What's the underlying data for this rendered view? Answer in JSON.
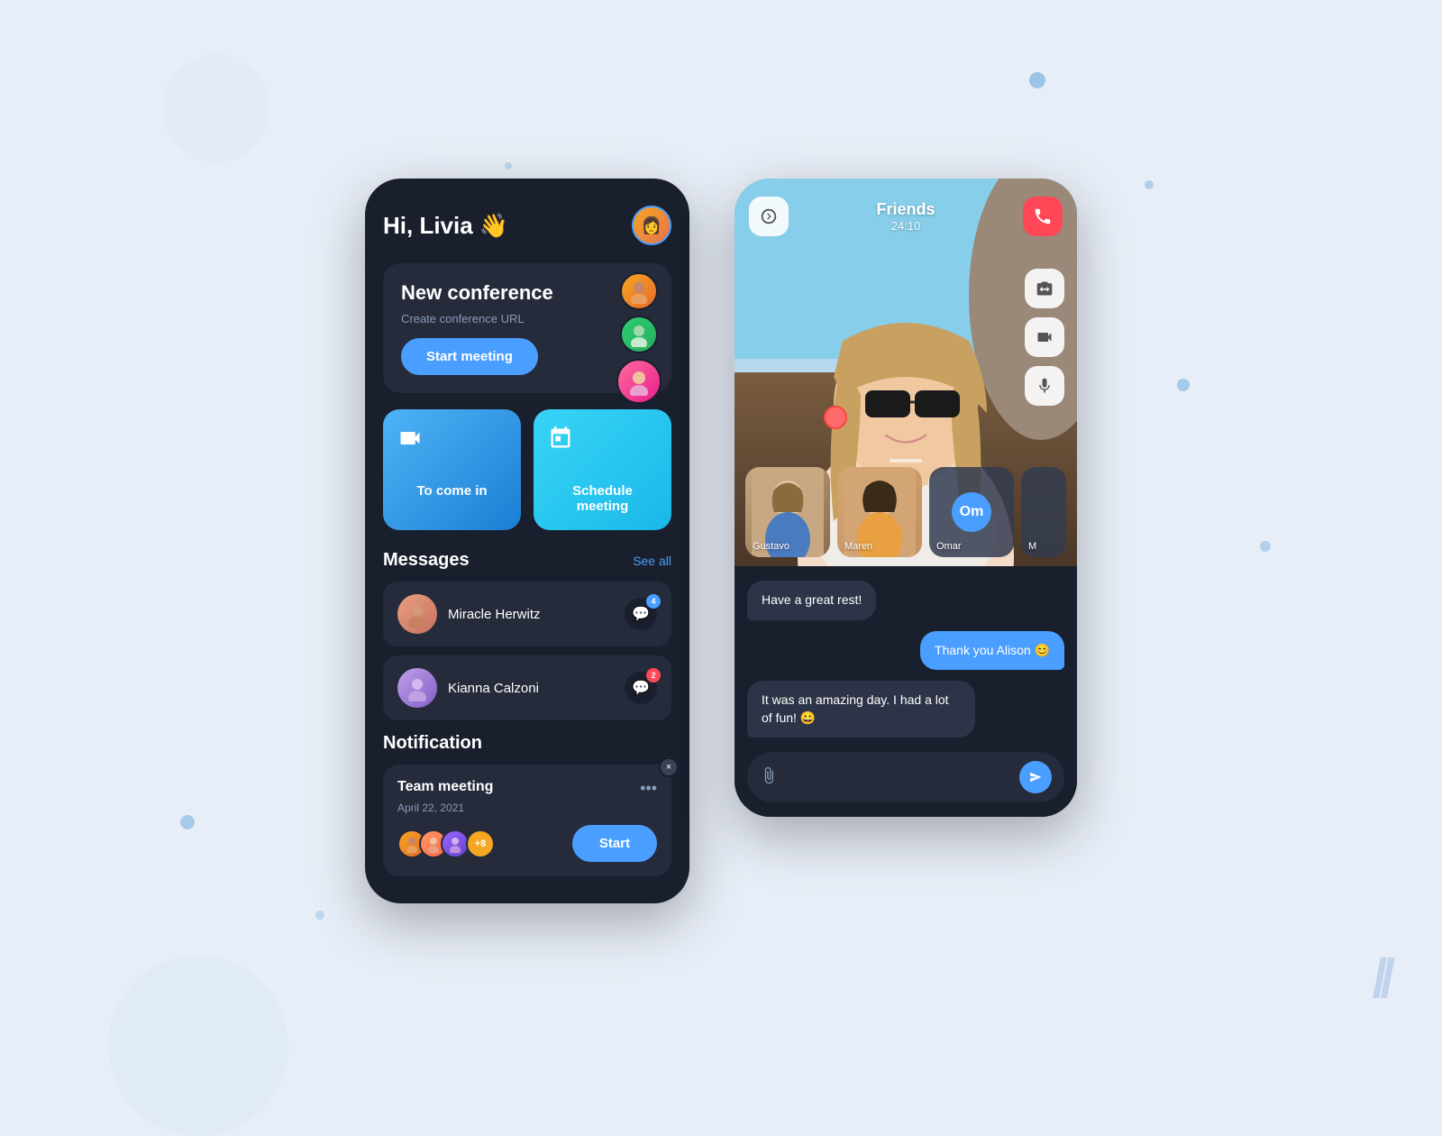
{
  "background": {
    "color": "#e8eef7"
  },
  "leftPhone": {
    "greeting": "Hi, Livia 👋",
    "userAvatarEmoji": "👩",
    "conferenceCard": {
      "title": "New conference",
      "subtitle": "Create conference URL",
      "startButton": "Start meeting",
      "floatingAvatars": [
        "👩‍🦰",
        "👩",
        "👩‍🦳"
      ]
    },
    "quickActions": [
      {
        "icon": "▶",
        "label": "To come in",
        "gradient": "blue"
      },
      {
        "icon": "📅",
        "label": "Schedule meeting",
        "gradient": "cyan"
      }
    ],
    "messagesSection": {
      "title": "Messages",
      "seeAll": "See all",
      "items": [
        {
          "name": "Miracle Herwitz",
          "avatarEmoji": "👩",
          "badgeCount": "4",
          "badgeColor": "blue"
        },
        {
          "name": "Kianna Calzoni",
          "avatarEmoji": "👩‍🦳",
          "badgeCount": "2",
          "badgeColor": "red"
        }
      ]
    },
    "notificationSection": {
      "title": "Notification",
      "card": {
        "title": "Team meeting",
        "date": "April 22, 2021",
        "closeBtn": "×",
        "moreBtn": "•••",
        "avatarEmojis": [
          "👩‍🦰",
          "👩",
          "👩‍🦱"
        ],
        "extraCount": "+8",
        "startBtn": "Start"
      }
    }
  },
  "rightPhone": {
    "callHeader": {
      "backIcon": "🔕",
      "callName": "Friends",
      "callTimer": "24:10",
      "endCallIcon": "📵"
    },
    "sideControls": [
      "📷",
      "📹",
      "🎤"
    ],
    "participants": [
      {
        "name": "Gustavo",
        "type": "video"
      },
      {
        "name": "Maren",
        "type": "video"
      },
      {
        "name": "Omar",
        "initials": "Om",
        "type": "avatar"
      },
      {
        "name": "M",
        "type": "partial"
      }
    ],
    "chat": {
      "messages": [
        {
          "text": "Have a great rest!",
          "type": "incoming"
        },
        {
          "text": "Thank you Alison 😊",
          "type": "outgoing"
        },
        {
          "text": "It was an amazing day. I had a lot of fun! 😀",
          "type": "incoming"
        }
      ],
      "inputPlaceholder": ""
    }
  }
}
